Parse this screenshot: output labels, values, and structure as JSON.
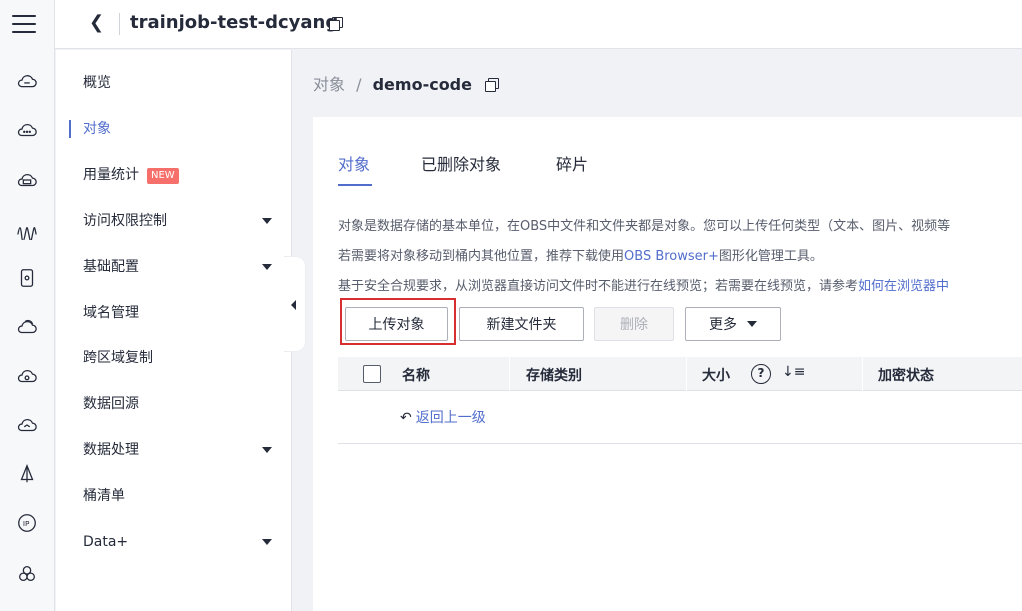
{
  "header": {
    "back_icon": "chevron-left-icon",
    "bucket_name": "trainjob-test-dcyang",
    "copy_icon": "copy-icon"
  },
  "rail": {
    "menu_icon": "hamburger-menu-icon",
    "icons": [
      "cloud-disk-icon",
      "cloud-more-icon",
      "cloud-storage-icon",
      "waveform-icon",
      "device-icon",
      "cloud-sync-icon",
      "cloud-gear-icon",
      "cloud-arrow-icon",
      "sail-icon",
      "ip-icon",
      "cluster-icon"
    ]
  },
  "sidebar": {
    "items": [
      {
        "label": "概览"
      },
      {
        "label": "对象",
        "active": true
      },
      {
        "label": "用量统计",
        "badge": "NEW"
      },
      {
        "label": "访问权限控制",
        "expandable": true
      },
      {
        "label": "基础配置",
        "expandable": true
      },
      {
        "label": "域名管理"
      },
      {
        "label": "跨区域复制"
      },
      {
        "label": "数据回源"
      },
      {
        "label": "数据处理",
        "expandable": true
      },
      {
        "label": "桶清单"
      },
      {
        "label": "Data+",
        "expandable": true
      }
    ],
    "collapse_icon": "collapse-left-icon"
  },
  "breadcrumb": {
    "parent": "对象",
    "separator": "/",
    "current": "demo-code"
  },
  "tabs": [
    {
      "label": "对象",
      "active": true
    },
    {
      "label": "已删除对象"
    },
    {
      "label": "碎片"
    }
  ],
  "descriptions": {
    "line1": "对象是数据存储的基本单位，在OBS中文件和文件夹都是对象。您可以上传任何类型（文本、图片、视频等",
    "line2_pre": "若需要将对象移动到桶内其他位置，推荐下载使用",
    "line2_link": "OBS Browser+",
    "line2_post": "图形化管理工具。",
    "line3_pre": "基于安全合规要求，从浏览器直接访问文件时不能进行在线预览；若需要在线预览，请参考",
    "line3_link": "如何在浏览器中"
  },
  "toolbar": {
    "upload": "上传对象",
    "new_folder": "新建文件夹",
    "delete": "删除",
    "more": "更多"
  },
  "table": {
    "columns": [
      "名称",
      "存储类别",
      "大小",
      "加密状态"
    ],
    "help_icon": "question-circle-icon",
    "sort_icon": "sort-icon",
    "return_label": "返回上一级",
    "return_icon": "return-arrow-icon"
  },
  "colors": {
    "accent": "#526ecc",
    "highlight_border": "#d72f2f",
    "badge": "#f66f6a"
  }
}
